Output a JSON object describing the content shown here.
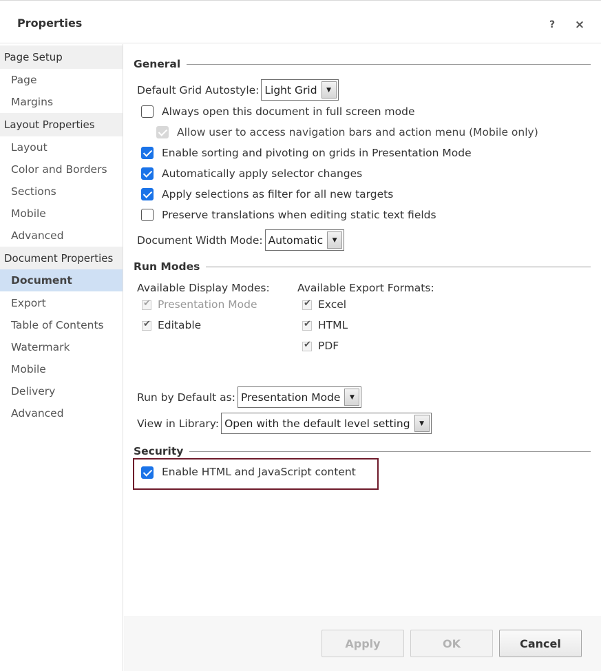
{
  "dialog": {
    "title": "Properties",
    "help_label": "?",
    "close_label": "×"
  },
  "sidebar": {
    "groups": [
      {
        "heading": "Page Setup",
        "items": [
          "Page",
          "Margins"
        ]
      },
      {
        "heading": "Layout Properties",
        "items": [
          "Layout",
          "Color and Borders",
          "Sections",
          "Mobile",
          "Advanced"
        ]
      },
      {
        "heading": "Document Properties",
        "items": [
          "Document",
          "Export",
          "Table of Contents",
          "Watermark",
          "Mobile",
          "Delivery",
          "Advanced"
        ]
      }
    ],
    "active": "Document"
  },
  "general": {
    "heading": "General",
    "grid_autostyle_label": "Default Grid Autostyle:",
    "grid_autostyle_value": "Light Grid",
    "options": [
      {
        "label": "Always open this document in full screen mode",
        "checked": false
      },
      {
        "label": "Allow user to access navigation bars and action menu (Mobile only)",
        "checked": true,
        "disabled": true
      },
      {
        "label": "Enable sorting and pivoting on grids in Presentation Mode",
        "checked": true
      },
      {
        "label": "Automatically apply selector changes",
        "checked": true
      },
      {
        "label": "Apply selections as filter for all new targets",
        "checked": true
      },
      {
        "label": "Preserve translations when editing static text fields",
        "checked": false
      }
    ],
    "width_mode_label": "Document Width Mode:",
    "width_mode_value": "Automatic"
  },
  "run_modes": {
    "heading": "Run Modes",
    "display_label": "Available Display Modes:",
    "display_modes": [
      {
        "label": "Presentation Mode",
        "checked": true,
        "disabled": true
      },
      {
        "label": "Editable",
        "checked": true
      }
    ],
    "export_label": "Available Export Formats:",
    "export_formats": [
      {
        "label": "Excel",
        "checked": true
      },
      {
        "label": "HTML",
        "checked": true
      },
      {
        "label": "PDF",
        "checked": true
      }
    ],
    "run_default_label": "Run by Default as:",
    "run_default_value": "Presentation Mode",
    "library_label": "View in Library:",
    "library_value": "Open with the default level setting"
  },
  "security": {
    "heading": "Security",
    "option": {
      "label": "Enable HTML and JavaScript content",
      "checked": true
    },
    "highlight_color": "#6e1a2a"
  },
  "buttons": {
    "apply": "Apply",
    "ok": "OK",
    "cancel": "Cancel"
  },
  "colors": {
    "checkbox_accent": "#1a73e8",
    "sidebar_active_bg": "#cfe0f4",
    "sidebar_group_bg": "#f0f0f0"
  }
}
